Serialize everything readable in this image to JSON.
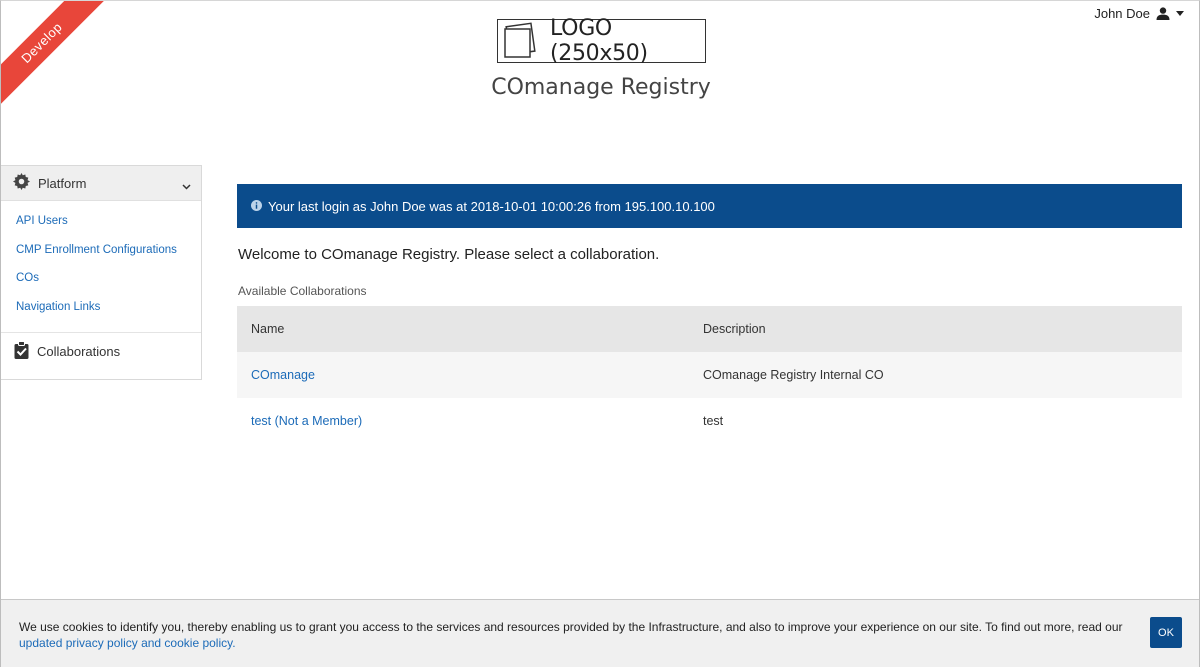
{
  "ribbon": {
    "label": "Develop"
  },
  "user": {
    "name": "John Doe"
  },
  "logo": {
    "text": "LOGO (250x50)"
  },
  "app": {
    "title": "COmanage Registry"
  },
  "sidebar": {
    "section_label": "Platform",
    "items": [
      {
        "label": "API Users"
      },
      {
        "label": "CMP Enrollment Configurations"
      },
      {
        "label": "COs"
      },
      {
        "label": "Navigation Links"
      }
    ],
    "collaborations_label": "Collaborations"
  },
  "alert": {
    "text": "Your last login as John Doe was at 2018-10-01 10:00:26 from 195.100.10.100"
  },
  "main": {
    "welcome": "Welcome to COmanage Registry. Please select a collaboration.",
    "available_label": "Available Collaborations",
    "columns": {
      "name": "Name",
      "description": "Description"
    },
    "rows": [
      {
        "name": "COmanage",
        "description": "COmanage Registry Internal CO"
      },
      {
        "name": "test (Not a Member)",
        "description": "test"
      }
    ]
  },
  "cookie": {
    "text": "We use cookies to identify you, thereby enabling us to grant you access to the services and resources provided by the Infrastructure, and also to improve your experience on our site. To find out more, read our",
    "link": "updated privacy policy and cookie policy.",
    "ok_label": "OK"
  },
  "colors": {
    "accent": "#0b4c8c",
    "link": "#1c6bb8",
    "ribbon": "#e8463a"
  }
}
